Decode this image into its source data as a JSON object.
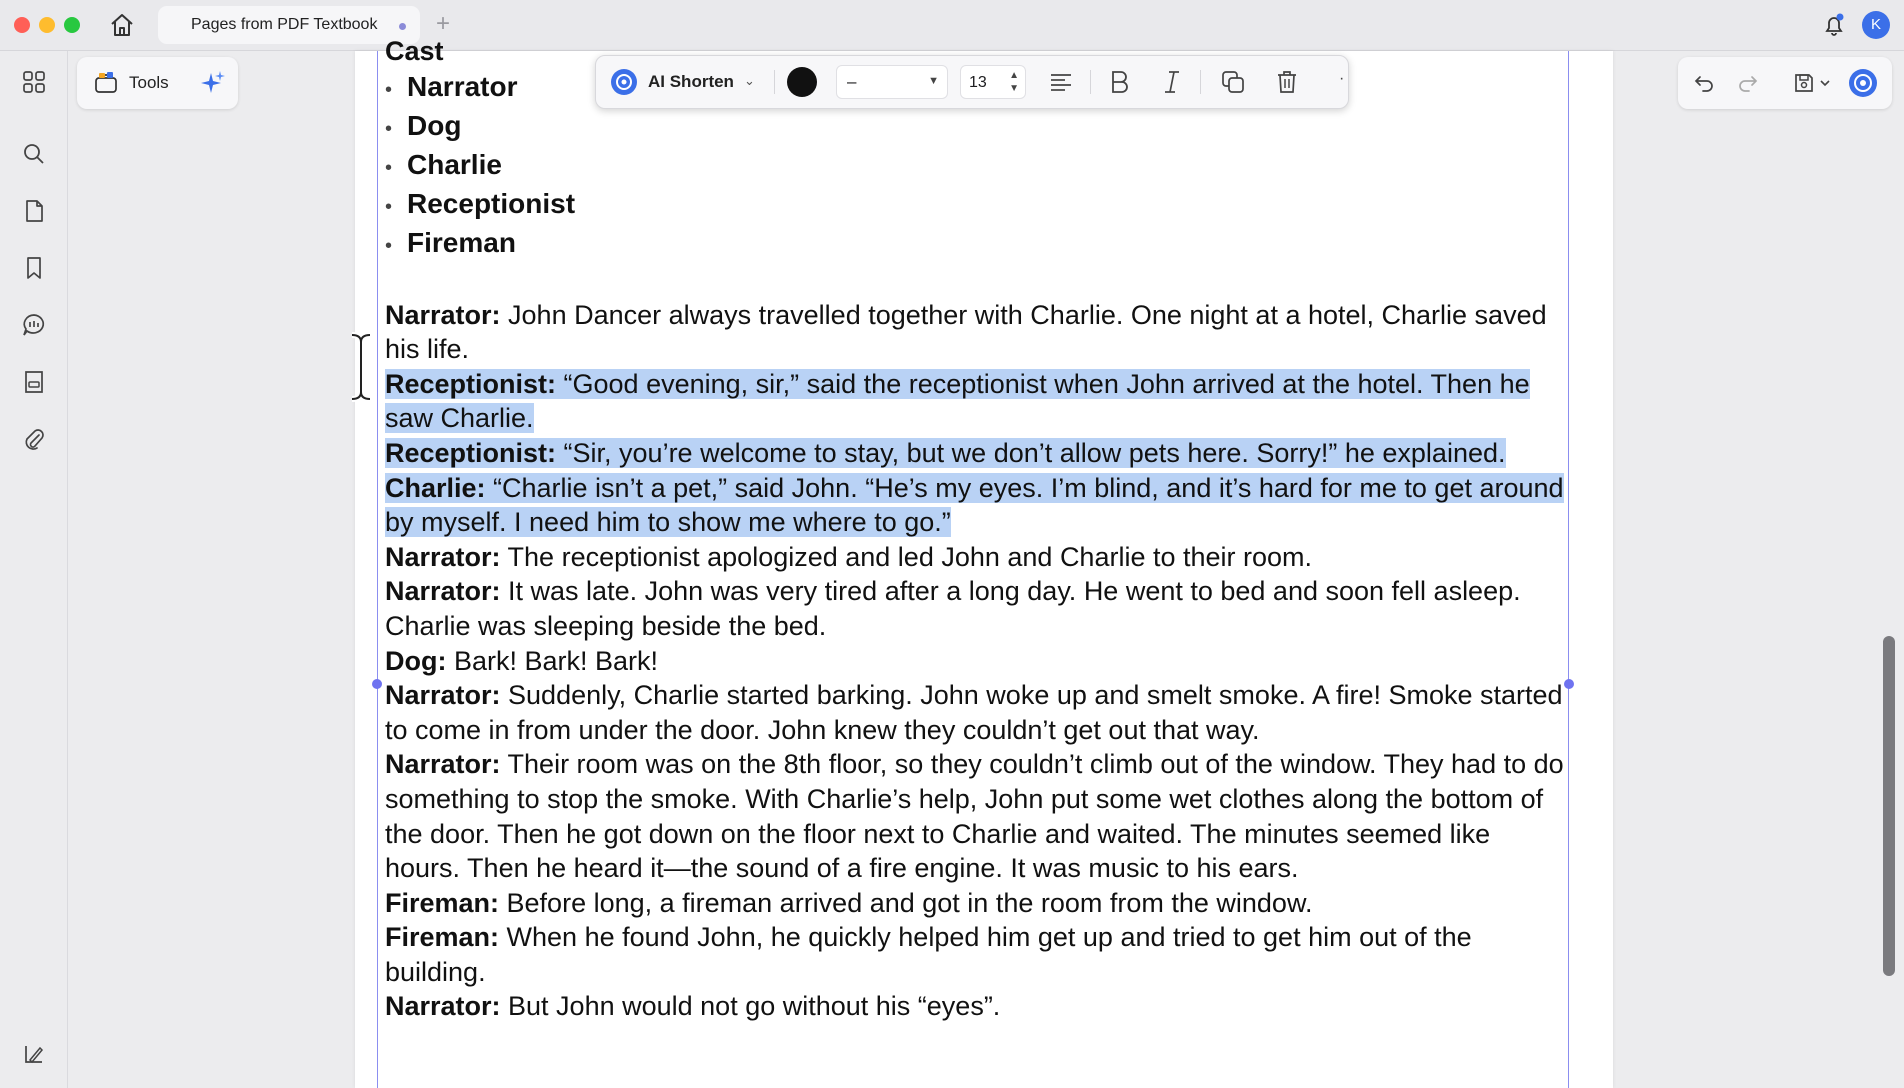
{
  "app": {
    "tab_title": "Pages from PDF Textbook",
    "avatar_initial": "K"
  },
  "left_toolbar": {
    "tools_label": "Tools"
  },
  "edit_toolbar": {
    "ai_label": "AI Shorten",
    "font_name": "–",
    "font_size": "13",
    "text_color": "#111111"
  },
  "document": {
    "cast_heading": "Cast",
    "cast": [
      "Narrator",
      "Dog",
      "Charlie",
      "Receptionist",
      "Fireman"
    ],
    "lines": [
      {
        "speaker": "Narrator:",
        "text": " John Dancer always travelled together with Charlie. One night at a hotel, Charlie saved his life.",
        "highlighted": false
      },
      {
        "speaker": "Receptionist:",
        "text": " “Good evening, sir,” said the receptionist when John arrived at the hotel. Then he saw Charlie.",
        "highlighted": true
      },
      {
        "speaker": "Receptionist:",
        "text": " “Sir, you’re welcome to stay, but we don’t allow pets here. Sorry!” he explained.",
        "highlighted": true
      },
      {
        "speaker": "Charlie:",
        "text": " “Charlie isn’t a pet,” said John. “He’s my eyes. I’m blind, and it’s hard for me to get around by myself. I need him to show me where to go.”",
        "highlighted": true
      },
      {
        "speaker": "Narrator:",
        "text": " The receptionist apologized and led John and Charlie to their room.",
        "highlighted": false
      },
      {
        "speaker": "Narrator:",
        "text": " It was late. John was very tired after a long day. He went to bed and soon fell asleep. Charlie was sleeping beside the bed.",
        "highlighted": false
      },
      {
        "speaker": "Dog:",
        "text": " Bark! Bark! Bark!",
        "highlighted": false
      },
      {
        "speaker": "Narrator:",
        "text": " Suddenly, Charlie started barking. John woke up and smelt smoke. A fire! Smoke started to come in from under the door. John knew they couldn’t get out that way.",
        "highlighted": false
      },
      {
        "speaker": "Narrator:",
        "text": " Their room was on the 8th floor, so they couldn’t climb out of the window. They had to do something to stop the smoke. With Charlie’s help, John put some wet clothes along the bottom of the door. Then he got down on the floor next to Charlie and waited. The minutes seemed like hours. Then he heard it—the sound of a fire engine. It was music to his ears.",
        "highlighted": false
      },
      {
        "speaker": "Fireman:",
        "text": " Before long, a fireman arrived and got in the room from the window.",
        "highlighted": false
      },
      {
        "speaker": "Fireman:",
        "text": " When he found John, he quickly helped him get up and tried to get him out of the building.",
        "highlighted": false
      },
      {
        "speaker": "Narrator:",
        "text": " But John would not go without his “eyes”.",
        "highlighted": false
      }
    ]
  }
}
